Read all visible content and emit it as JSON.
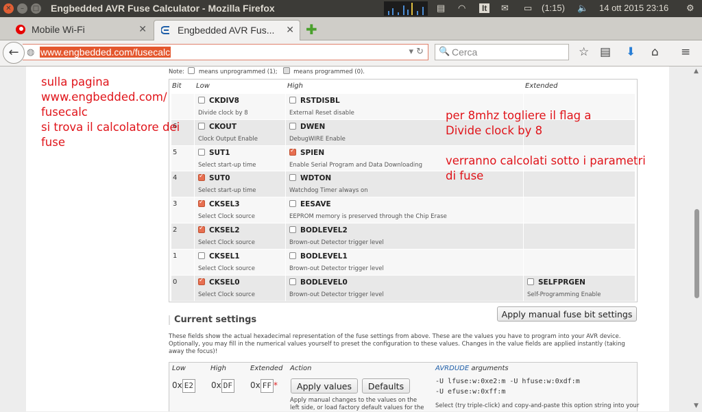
{
  "window": {
    "title": "Engbedded AVR Fuse Calculator - Mozilla Firefox"
  },
  "tray": {
    "indicator": "It",
    "battery": "(1:15)",
    "datetime": "14 ott 2015 23:16"
  },
  "tabs": [
    {
      "label": "Mobile Wi-Fi"
    },
    {
      "label": "Engbedded AVR Fus..."
    }
  ],
  "urlbar": {
    "url": "www.engbedded.com/fusecalc"
  },
  "search": {
    "placeholder": "Cerca"
  },
  "note": {
    "prefix": "Note:",
    "unprog": "means unprogrammed (1);",
    "prog": "means programmed (0)."
  },
  "fuse_table": {
    "headers": {
      "bit": "Bit",
      "low": "Low",
      "high": "High",
      "ext": "Extended"
    },
    "rows": [
      {
        "bit": "",
        "low": {
          "name": "CKDIV8",
          "desc": "Divide clock by 8",
          "checked": false
        },
        "high": {
          "name": "RSTDISBL",
          "desc": "External Reset disable",
          "checked": false
        }
      },
      {
        "bit": "6",
        "low": {
          "name": "CKOUT",
          "desc": "Clock Output Enable",
          "checked": false
        },
        "high": {
          "name": "DWEN",
          "desc": "DebugWIRE Enable",
          "checked": false
        }
      },
      {
        "bit": "5",
        "low": {
          "name": "SUT1",
          "desc": "Select start-up time",
          "checked": false
        },
        "high": {
          "name": "SPIEN",
          "desc": "Enable Serial Program and Data Downloading",
          "checked": true
        }
      },
      {
        "bit": "4",
        "low": {
          "name": "SUT0",
          "desc": "Select start-up time",
          "checked": true
        },
        "high": {
          "name": "WDTON",
          "desc": "Watchdog Timer always on",
          "checked": false
        }
      },
      {
        "bit": "3",
        "low": {
          "name": "CKSEL3",
          "desc": "Select Clock source",
          "checked": true
        },
        "high": {
          "name": "EESAVE",
          "desc": "EEPROM memory is preserved through the Chip Erase",
          "checked": false
        }
      },
      {
        "bit": "2",
        "low": {
          "name": "CKSEL2",
          "desc": "Select Clock source",
          "checked": true
        },
        "high": {
          "name": "BODLEVEL2",
          "desc": "Brown-out Detector trigger level",
          "checked": false
        }
      },
      {
        "bit": "1",
        "low": {
          "name": "CKSEL1",
          "desc": "Select Clock source",
          "checked": false
        },
        "high": {
          "name": "BODLEVEL1",
          "desc": "Brown-out Detector trigger level",
          "checked": false
        }
      },
      {
        "bit": "0",
        "low": {
          "name": "CKSEL0",
          "desc": "Select Clock source",
          "checked": true
        },
        "high": {
          "name": "BODLEVEL0",
          "desc": "Brown-out Detector trigger level",
          "checked": false
        },
        "ext": {
          "name": "SELFPRGEN",
          "desc": "Self-Programming Enable",
          "checked": false
        }
      }
    ]
  },
  "current": {
    "heading": "Current settings",
    "apply_manual": "Apply manual fuse bit settings",
    "desc": "These fields show the actual hexadecimal representation of the fuse settings from above. These are the values you have to program into your AVR device. Optionally, you may fill in the numerical values yourself to preset the configuration to these values. Changes in the value fields are applied instantly (taking away the focus)!",
    "headers": {
      "low": "Low",
      "high": "High",
      "ext": "Extended",
      "action": "Action",
      "avrdude": "AVRDUDE",
      "args": "arguments"
    },
    "prefix": "0x",
    "low_value": "E2",
    "high_value": "DF",
    "ext_value": "FF",
    "star": "*",
    "apply_values": "Apply values",
    "defaults": "Defaults",
    "action_desc": "Apply manual changes to the values on the left side, or load factory default values for the",
    "avrdude_line1": "-U lfuse:w:0xe2:m -U hfuse:w:0xdf:m",
    "avrdude_line2": "-U efuse:w:0xff:m",
    "avrdude_help": "Select (try triple-click) and copy-and-paste this option string into your"
  },
  "annotations": {
    "left_lines": [
      "sulla pagina",
      "www.engbedded.com/",
      "fusecalc",
      "si trova il calcolatore dei",
      "fuse"
    ],
    "right1_lines": [
      "per 8mhz togliere il flag a",
      "Divide clock by 8"
    ],
    "right2_lines": [
      "verranno calcolati sotto i parametri",
      "di fuse"
    ]
  },
  "colors": {
    "accent": "#e4572e",
    "annotation": "#e0141a",
    "checkbox_on": "#e76f51"
  }
}
